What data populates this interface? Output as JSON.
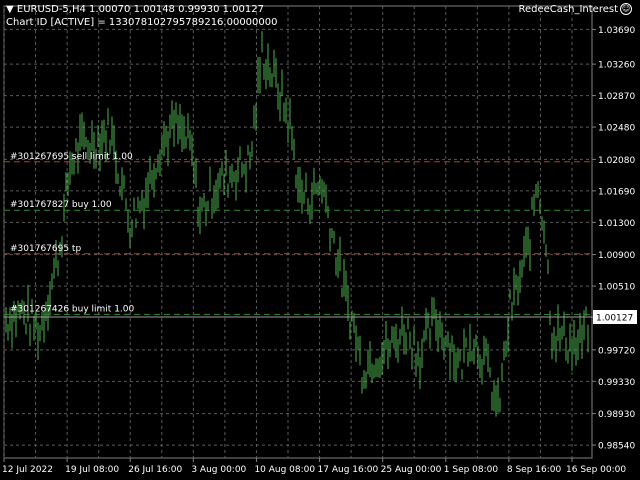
{
  "header": {
    "symbol_line": "▼ EURUSD-5,H4  1.00070 1.00148 0.99930 1.00127",
    "chart_id_line": "Chart ID [ACTIVE] = 133078102795789216.00000000",
    "indicator_label": "RedeeCash_Interest",
    "indicator_icon": "smiley-icon"
  },
  "colors": {
    "background": "#000000",
    "grid": "#5a5a5a",
    "price": "#4caf50",
    "sell_line": "#c0392b",
    "buy_line": "#2e8b2e",
    "axis_text": "#ffffff"
  },
  "chart_data": {
    "type": "bar",
    "symbol": "EURUSD-5",
    "timeframe": "H4",
    "ylim": [
      0.9838,
      1.0398
    ],
    "y_ticks": [
      "1.03690",
      "1.03260",
      "1.02870",
      "1.02480",
      "1.02080",
      "1.01690",
      "1.01300",
      "1.00900",
      "1.00510",
      "1.00127",
      "0.99720",
      "0.99330",
      "0.98930",
      "0.98540"
    ],
    "y_tick_values": [
      1.0369,
      1.0326,
      1.0287,
      1.0248,
      1.0208,
      1.0169,
      1.013,
      1.009,
      1.0051,
      1.00127,
      0.9972,
      0.9933,
      0.9893,
      0.9854
    ],
    "x_ticks": [
      "12 Jul 2022",
      "19 Jul 08:00",
      "26 Jul 16:00",
      "3 Aug 00:00",
      "10 Aug 08:00",
      "17 Aug 16:00",
      "25 Aug 00:00",
      "1 Sep 08:00",
      "8 Sep 16:00",
      "16 Sep 00:00"
    ],
    "current_price": "1.00127",
    "ohlc": {
      "open": 1.0007,
      "high": 1.00148,
      "low": 0.9993,
      "close": 1.00127
    },
    "trend_points": [
      [
        0,
        1.0005
      ],
      [
        20,
        1.002
      ],
      [
        40,
        0.9995
      ],
      [
        60,
        1.01
      ],
      [
        70,
        1.02
      ],
      [
        80,
        1.0225
      ],
      [
        95,
        1.023
      ],
      [
        110,
        1.0245
      ],
      [
        130,
        1.013
      ],
      [
        145,
        1.0165
      ],
      [
        160,
        1.0225
      ],
      [
        175,
        1.025
      ],
      [
        190,
        1.0225
      ],
      [
        200,
        1.014
      ],
      [
        215,
        1.0175
      ],
      [
        235,
        1.0195
      ],
      [
        250,
        1.0205
      ],
      [
        262,
        1.034
      ],
      [
        270,
        1.032
      ],
      [
        280,
        1.029
      ],
      [
        290,
        1.025
      ],
      [
        300,
        1.0165
      ],
      [
        310,
        1.016
      ],
      [
        322,
        1.018
      ],
      [
        335,
        1.01
      ],
      [
        345,
        1.004
      ],
      [
        355,
        0.9995
      ],
      [
        362,
        0.995
      ],
      [
        375,
        0.9965
      ],
      [
        390,
        0.9975
      ],
      [
        405,
        1.0
      ],
      [
        420,
        0.9965
      ],
      [
        435,
        1.001
      ],
      [
        450,
        0.998
      ],
      [
        460,
        0.995
      ],
      [
        470,
        0.999
      ],
      [
        485,
        0.996
      ],
      [
        498,
        0.9895
      ],
      [
        510,
        1.002
      ],
      [
        520,
        1.006
      ],
      [
        530,
        1.011
      ],
      [
        537,
        1.0185
      ],
      [
        545,
        1.012
      ],
      [
        552,
        0.9995
      ],
      [
        565,
        0.9985
      ],
      [
        578,
        0.9975
      ],
      [
        590,
        1.001
      ]
    ],
    "order_lines": [
      {
        "label": "#301267695 sell limit 1.00",
        "price": 1.0205,
        "kind": "sell"
      },
      {
        "label": "#301767827 buy 1.00",
        "price": 1.0145,
        "kind": "buy"
      },
      {
        "label": "#301767695 tp",
        "price": 1.0091,
        "kind": "sell"
      },
      {
        "label": "#301267426 buy limit 1.00",
        "price": 1.0016,
        "kind": "buy"
      }
    ]
  }
}
